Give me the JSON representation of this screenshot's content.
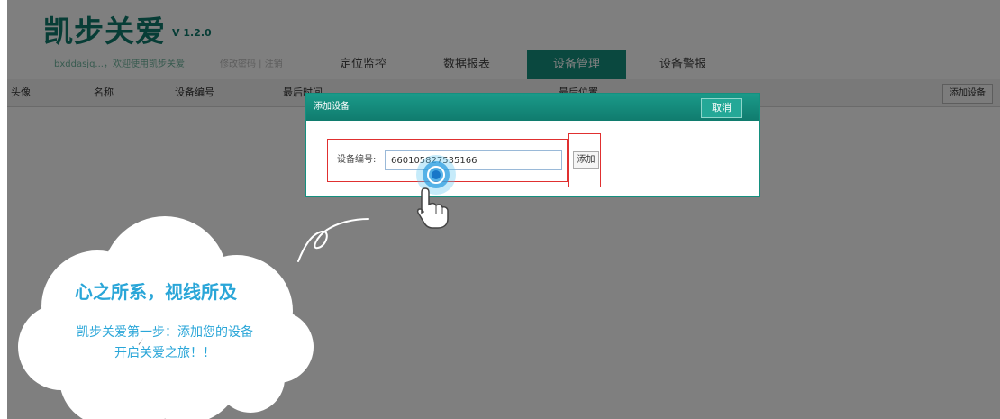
{
  "header": {
    "logo": "凯步关爱",
    "version": "V 1.2.0",
    "welcome": "bxddasjq...，欢迎使用凯步关爱",
    "links": "修改密码 | 注销"
  },
  "nav": {
    "items": [
      {
        "label": "定位监控"
      },
      {
        "label": "数据报表"
      },
      {
        "label": "设备管理"
      },
      {
        "label": "设备警报"
      }
    ]
  },
  "table": {
    "columns": [
      "头像",
      "名称",
      "设备编号",
      "最后时间",
      "最后位置"
    ],
    "add_button": "添加设备"
  },
  "modal": {
    "title": "添加设备",
    "cancel": "取消",
    "field_label": "设备编号:",
    "field_value": "660105827535166",
    "add_button": "添加"
  },
  "promo": {
    "title": "心之所系，视线所及",
    "line1": "凯步关爱第一步：添加您的设备",
    "line2": "开启关爱之旅！！"
  },
  "colors": {
    "brand": "#14907f",
    "highlight_box": "#e03030",
    "promo_text": "#2aa6d8"
  }
}
